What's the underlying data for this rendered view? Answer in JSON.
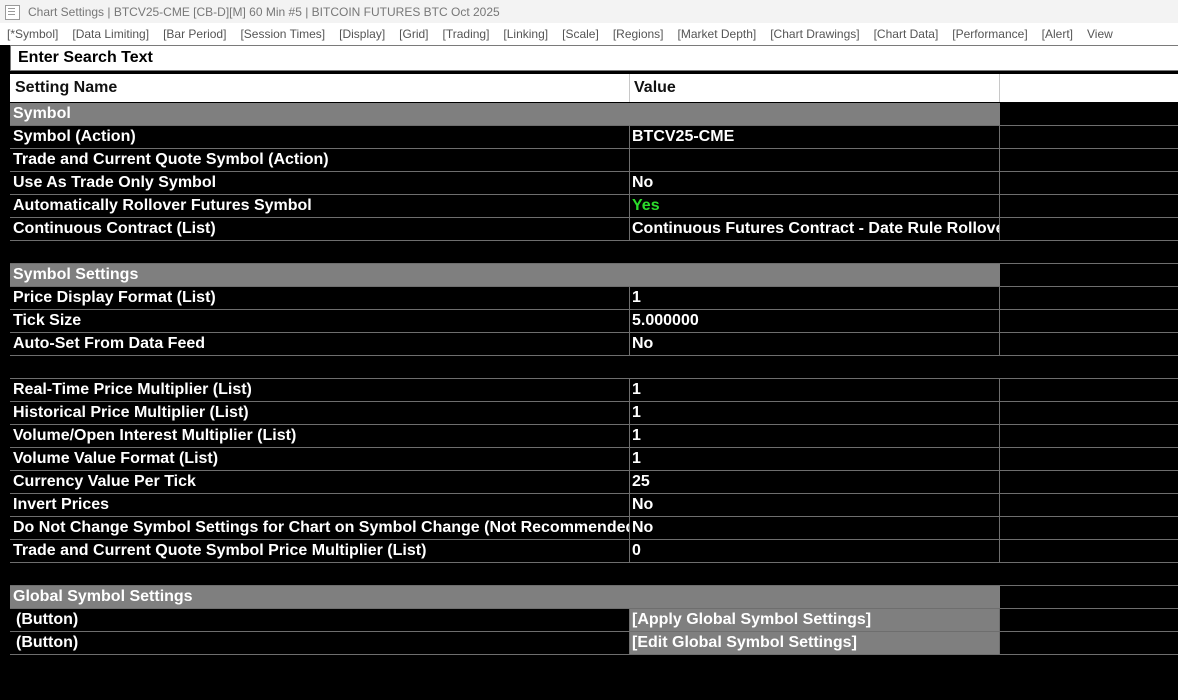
{
  "window": {
    "title": "Chart Settings | BTCV25-CME [CB-D][M]  60 Min  #5 | BITCOIN FUTURES BTC Oct 2025",
    "icon": "settings-window-icon"
  },
  "tabs": [
    "[*Symbol]",
    "[Data Limiting]",
    "[Bar Period]",
    "[Session Times]",
    "[Display]",
    "[Grid]",
    "[Trading]",
    "[Linking]",
    "[Scale]",
    "[Regions]",
    "[Market Depth]",
    "[Chart Drawings]",
    "[Chart Data]",
    "[Performance]",
    "[Alert]",
    "View"
  ],
  "search": {
    "text": "Enter Search Text"
  },
  "table": {
    "header": {
      "name": "Setting Name",
      "value": "Value"
    },
    "rows": [
      {
        "type": "section",
        "name": "Symbol"
      },
      {
        "type": "item",
        "name": "Symbol (Action)",
        "value": "BTCV25-CME"
      },
      {
        "type": "item",
        "name": "Trade and Current Quote Symbol (Action)",
        "value": ""
      },
      {
        "type": "item",
        "name": "Use As Trade Only Symbol",
        "value": "No"
      },
      {
        "type": "item",
        "name": "Automatically Rollover Futures Symbol",
        "value": "Yes",
        "color": "#2bdc2b"
      },
      {
        "type": "item",
        "name": "Continuous Contract (List)",
        "value": "Continuous Futures Contract - Date Rule Rollover"
      },
      {
        "type": "empty"
      },
      {
        "type": "section",
        "name": "Symbol Settings"
      },
      {
        "type": "item",
        "name": "Price Display Format (List)",
        "value": "1"
      },
      {
        "type": "item",
        "name": "Tick Size",
        "value": "5.000000"
      },
      {
        "type": "item",
        "name": "Auto-Set From Data Feed",
        "value": "No"
      },
      {
        "type": "empty"
      },
      {
        "type": "item",
        "name": "Real-Time Price Multiplier (List)",
        "value": "1"
      },
      {
        "type": "item",
        "name": "Historical Price Multiplier (List)",
        "value": "1"
      },
      {
        "type": "item",
        "name": "Volume/Open Interest Multiplier (List)",
        "value": "1"
      },
      {
        "type": "item",
        "name": "Volume Value Format (List)",
        "value": "1"
      },
      {
        "type": "item",
        "name": "Currency Value Per Tick",
        "value": "25"
      },
      {
        "type": "item",
        "name": "Invert Prices",
        "value": "No"
      },
      {
        "type": "item",
        "name": "Do Not Change Symbol Settings for Chart on Symbol Change (Not Recommended)",
        "value": "No"
      },
      {
        "type": "item",
        "name": "Trade and Current Quote Symbol Price Multiplier (List)",
        "value": "0"
      },
      {
        "type": "empty"
      },
      {
        "type": "section",
        "name": "Global Symbol Settings"
      },
      {
        "type": "button",
        "name": "(Button)",
        "value": "[Apply Global Symbol Settings]"
      },
      {
        "type": "button",
        "name": "(Button)",
        "value": "[Edit Global Symbol Settings]"
      }
    ]
  }
}
